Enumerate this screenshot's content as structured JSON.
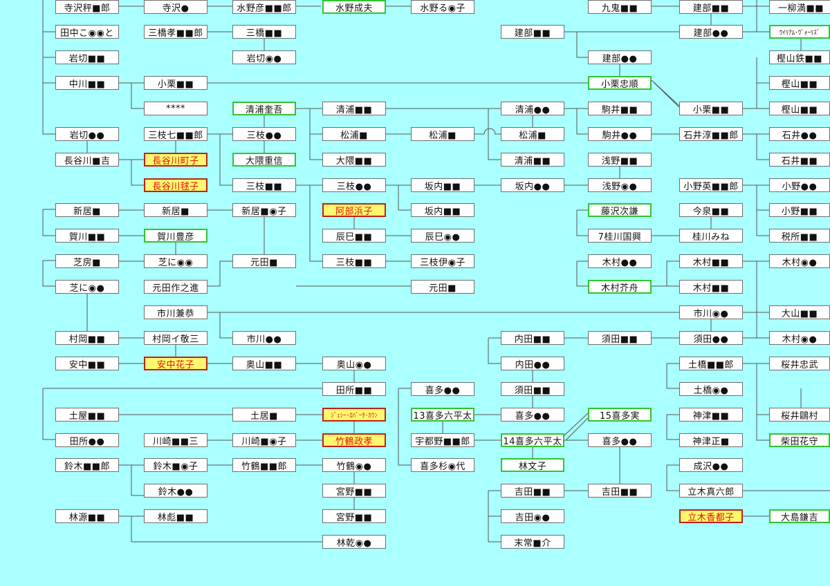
{
  "nodes": [
    {
      "id": "c1_1",
      "label": "寺沢秤■郎",
      "type": "normal"
    },
    {
      "id": "c1_2",
      "label": "田中こ◉◉と",
      "type": "normal"
    },
    {
      "id": "c1_3",
      "label": "岩切■■",
      "type": "normal"
    },
    {
      "id": "c1_4",
      "label": "中川■■",
      "type": "normal"
    },
    {
      "id": "c1_5",
      "label": "岩切●●",
      "type": "normal"
    },
    {
      "id": "c1_6",
      "label": "長谷川■吉",
      "type": "normal"
    },
    {
      "id": "c1_7",
      "label": "新居■",
      "type": "normal"
    },
    {
      "id": "c1_8",
      "label": "賀川■■",
      "type": "normal"
    },
    {
      "id": "c1_9",
      "label": "芝房■",
      "type": "normal"
    },
    {
      "id": "c1_10",
      "label": "芝に◉●",
      "type": "normal"
    },
    {
      "id": "c1_11",
      "label": "村岡■■",
      "type": "normal"
    },
    {
      "id": "c1_12",
      "label": "安中■■",
      "type": "normal"
    },
    {
      "id": "c1_13",
      "label": "土屋■■",
      "type": "normal"
    },
    {
      "id": "c1_14",
      "label": "田所●●",
      "type": "normal"
    },
    {
      "id": "c1_15",
      "label": "鈴木■■郎",
      "type": "normal"
    },
    {
      "id": "c1_16",
      "label": "林源■■",
      "type": "normal"
    },
    {
      "id": "c2_1",
      "label": "寺沢●",
      "type": "normal"
    },
    {
      "id": "c2_2",
      "label": "三橋孝■■郎",
      "type": "normal"
    },
    {
      "id": "c2_3",
      "label": "小栗■■",
      "type": "normal"
    },
    {
      "id": "c2_4",
      "label": "****",
      "type": "normal"
    },
    {
      "id": "c2_5",
      "label": "三枝七■■郎",
      "type": "normal"
    },
    {
      "id": "c2_6",
      "label": "長谷川町子",
      "type": "red"
    },
    {
      "id": "c2_7",
      "label": "長谷川毬子",
      "type": "red"
    },
    {
      "id": "c2_8",
      "label": "新居■",
      "type": "normal"
    },
    {
      "id": "c2_9",
      "label": "賀川豊彦",
      "type": "hl"
    },
    {
      "id": "c2_10",
      "label": "芝に◉◉",
      "type": "normal"
    },
    {
      "id": "c2_11",
      "label": "元田作之進",
      "type": "normal"
    },
    {
      "id": "c2_12",
      "label": "市川兼恭",
      "type": "normal"
    },
    {
      "id": "c2_13",
      "label": "村岡イ敬三",
      "type": "normal"
    },
    {
      "id": "c2_14",
      "label": "安中花子",
      "type": "red"
    },
    {
      "id": "c2_15",
      "label": "川崎■■三",
      "type": "normal"
    },
    {
      "id": "c2_16",
      "label": "鈴木■◉子",
      "type": "normal"
    },
    {
      "id": "c2_17",
      "label": "鈴木●●",
      "type": "normal"
    },
    {
      "id": "c2_18",
      "label": "林彪■■",
      "type": "normal"
    },
    {
      "id": "c3_1",
      "label": "水野彦■■郎",
      "type": "normal"
    },
    {
      "id": "c3_2",
      "label": "三橋■■",
      "type": "normal"
    },
    {
      "id": "c3_3",
      "label": "岩切◉●",
      "type": "normal"
    },
    {
      "id": "c3_4",
      "label": "清浦奎吾",
      "type": "hl"
    },
    {
      "id": "c3_5",
      "label": "三枝●●",
      "type": "normal"
    },
    {
      "id": "c3_6",
      "label": "大隈重信",
      "type": "hl"
    },
    {
      "id": "c3_7",
      "label": "三枝■■",
      "type": "normal"
    },
    {
      "id": "c3_8",
      "label": "新居■◉子",
      "type": "normal"
    },
    {
      "id": "c3_9",
      "label": "元田■",
      "type": "normal"
    },
    {
      "id": "c3_10",
      "label": "市川●●",
      "type": "normal"
    },
    {
      "id": "c3_11",
      "label": "奥山■■",
      "type": "normal"
    },
    {
      "id": "c3_12",
      "label": "土居■",
      "type": "normal"
    },
    {
      "id": "c3_13",
      "label": "川崎■◉子",
      "type": "normal"
    },
    {
      "id": "c3_14",
      "label": "竹鶴■■郎",
      "type": "normal"
    },
    {
      "id": "c4_1",
      "label": "水野成夫",
      "type": "hl"
    },
    {
      "id": "c4_2",
      "label": "清浦■■",
      "type": "normal"
    },
    {
      "id": "c4_3",
      "label": "松浦■",
      "type": "normal"
    },
    {
      "id": "c4_4",
      "label": "大隈■■",
      "type": "normal"
    },
    {
      "id": "c4_5",
      "label": "三枝●●",
      "type": "normal"
    },
    {
      "id": "c4_6",
      "label": "阿部浜子",
      "type": "red"
    },
    {
      "id": "c4_7",
      "label": "辰巳■■",
      "type": "normal"
    },
    {
      "id": "c4_8",
      "label": "三枝■■",
      "type": "normal"
    },
    {
      "id": "c4_9",
      "label": "奥山◉●",
      "type": "normal"
    },
    {
      "id": "c4_10",
      "label": "田所■■",
      "type": "normal"
    },
    {
      "id": "c4_11",
      "label": "ｼﾞｪｼｰ･ﾛﾊﾞｰﾀ･ｶｳﾝ",
      "type": "red",
      "small": true
    },
    {
      "id": "c4_12",
      "label": "竹鶴政孝",
      "type": "red"
    },
    {
      "id": "c4_13",
      "label": "竹鶴◉●",
      "type": "normal"
    },
    {
      "id": "c4_14",
      "label": "宮野■■",
      "type": "normal"
    },
    {
      "id": "c4_15",
      "label": "宮野■■",
      "type": "normal"
    },
    {
      "id": "c4_16",
      "label": "林乾◉●",
      "type": "normal"
    },
    {
      "id": "c5_1",
      "label": "水野る◉子",
      "type": "normal"
    },
    {
      "id": "c5_2",
      "label": "松浦■",
      "type": "normal"
    },
    {
      "id": "c5_3",
      "label": "坂内■■",
      "type": "normal"
    },
    {
      "id": "c5_4",
      "label": "坂内■■",
      "type": "normal"
    },
    {
      "id": "c5_5",
      "label": "辰巳◉●",
      "type": "normal"
    },
    {
      "id": "c5_6",
      "label": "三枝伊◉子",
      "type": "normal"
    },
    {
      "id": "c5_7",
      "label": "元田■",
      "type": "normal"
    },
    {
      "id": "c5_8",
      "label": "喜多●●",
      "type": "normal"
    },
    {
      "id": "c5_9",
      "label": "13喜多六平太",
      "type": "hl"
    },
    {
      "id": "c5_10",
      "label": "宇都野■■郎",
      "type": "normal"
    },
    {
      "id": "c5_11",
      "label": "喜多杉◉代",
      "type": "normal"
    },
    {
      "id": "c6_1",
      "label": "建部■■",
      "type": "normal"
    },
    {
      "id": "c6_2",
      "label": "清浦●●",
      "type": "normal"
    },
    {
      "id": "c6_3",
      "label": "松浦■",
      "type": "normal"
    },
    {
      "id": "c6_4",
      "label": "清浦■■",
      "type": "normal"
    },
    {
      "id": "c6_5",
      "label": "坂内●●",
      "type": "normal"
    },
    {
      "id": "c6_6",
      "label": "内田■■",
      "type": "normal"
    },
    {
      "id": "c6_7",
      "label": "内田●●",
      "type": "normal"
    },
    {
      "id": "c6_8",
      "label": "須田■■",
      "type": "normal"
    },
    {
      "id": "c6_9",
      "label": "喜多●●",
      "type": "normal"
    },
    {
      "id": "c6_10",
      "label": "14喜多六平太",
      "type": "hl"
    },
    {
      "id": "c6_11",
      "label": "林文子",
      "type": "hl"
    },
    {
      "id": "c6_12",
      "label": "吉田■■",
      "type": "normal"
    },
    {
      "id": "c6_13",
      "label": "吉田◉●",
      "type": "normal"
    },
    {
      "id": "c6_14",
      "label": "末常■介",
      "type": "normal"
    },
    {
      "id": "c7_1",
      "label": "九鬼■■",
      "type": "normal"
    },
    {
      "id": "c7_2",
      "label": "建部●●",
      "type": "normal"
    },
    {
      "id": "c7_3",
      "label": "小栗忠順",
      "type": "hl"
    },
    {
      "id": "c7_4",
      "label": "駒井■■",
      "type": "normal"
    },
    {
      "id": "c7_5",
      "label": "駒井●●",
      "type": "normal"
    },
    {
      "id": "c7_6",
      "label": "浅野■■",
      "type": "normal"
    },
    {
      "id": "c7_7",
      "label": "浅野◉●",
      "type": "normal"
    },
    {
      "id": "c7_8",
      "label": "藤沢次謙",
      "type": "hl"
    },
    {
      "id": "c7_9",
      "label": "7桂川国興",
      "type": "normal"
    },
    {
      "id": "c7_10",
      "label": "木村●●",
      "type": "normal"
    },
    {
      "id": "c7_11",
      "label": "木村芥舟",
      "type": "hl"
    },
    {
      "id": "c7_12",
      "label": "須田■■",
      "type": "normal"
    },
    {
      "id": "c7_13",
      "label": "15喜多実",
      "type": "hl"
    },
    {
      "id": "c7_14",
      "label": "喜多●●",
      "type": "normal"
    },
    {
      "id": "c7_15",
      "label": "吉田■■",
      "type": "normal"
    },
    {
      "id": "c8_1",
      "label": "建部■■",
      "type": "normal"
    },
    {
      "id": "c8_2",
      "label": "建部●●",
      "type": "normal"
    },
    {
      "id": "c8_3",
      "label": "小栗■■",
      "type": "normal"
    },
    {
      "id": "c8_4",
      "label": "石井淳■■郎",
      "type": "normal"
    },
    {
      "id": "c8_5",
      "label": "小野英■■郎",
      "type": "normal"
    },
    {
      "id": "c8_6",
      "label": "今泉■■",
      "type": "normal"
    },
    {
      "id": "c8_7",
      "label": "桂川みね",
      "type": "normal"
    },
    {
      "id": "c8_8",
      "label": "木村■■",
      "type": "normal"
    },
    {
      "id": "c8_9",
      "label": "木村■■",
      "type": "normal"
    },
    {
      "id": "c8_10",
      "label": "市川◉●",
      "type": "normal"
    },
    {
      "id": "c8_11",
      "label": "須田●●",
      "type": "normal"
    },
    {
      "id": "c8_12",
      "label": "土橋■■郎",
      "type": "normal"
    },
    {
      "id": "c8_13",
      "label": "土橋◉●",
      "type": "normal"
    },
    {
      "id": "c8_14",
      "label": "神津■■",
      "type": "normal"
    },
    {
      "id": "c8_15",
      "label": "神津正■",
      "type": "normal"
    },
    {
      "id": "c8_16",
      "label": "成沢●●",
      "type": "normal"
    },
    {
      "id": "c8_17",
      "label": "立木真六郎",
      "type": "normal"
    },
    {
      "id": "c8_18",
      "label": "立木香都子",
      "type": "red"
    },
    {
      "id": "c9_1",
      "label": "一柳満■■",
      "type": "normal"
    },
    {
      "id": "c9_2",
      "label": "ｳｲﾘｱﾑ･ｳﾞｫｰﾘｽﾞ",
      "type": "hl",
      "small": true
    },
    {
      "id": "c9_3",
      "label": "樫山鉄■■",
      "type": "normal"
    },
    {
      "id": "c9_4",
      "label": "樫山■■",
      "type": "normal"
    },
    {
      "id": "c9_5",
      "label": "樫山■■",
      "type": "normal"
    },
    {
      "id": "c9_6",
      "label": "石井●●",
      "type": "normal"
    },
    {
      "id": "c9_7",
      "label": "石井■■",
      "type": "normal"
    },
    {
      "id": "c9_8",
      "label": "小野●●",
      "type": "normal"
    },
    {
      "id": "c9_9",
      "label": "小野■■",
      "type": "normal"
    },
    {
      "id": "c9_10",
      "label": "税所■■",
      "type": "normal"
    },
    {
      "id": "c9_11",
      "label": "木村◉●",
      "type": "normal"
    },
    {
      "id": "c9_12",
      "label": "大山■■",
      "type": "normal"
    },
    {
      "id": "c9_13",
      "label": "木村◉●",
      "type": "normal"
    },
    {
      "id": "c9_14",
      "label": "桜井忠武",
      "type": "normal"
    },
    {
      "id": "c9_15",
      "label": "桜井鷗村",
      "type": "normal"
    },
    {
      "id": "c9_16",
      "label": "柴田花守",
      "type": "hl"
    },
    {
      "id": "c9_17",
      "label": "大島鎌吉",
      "type": "hl"
    }
  ]
}
